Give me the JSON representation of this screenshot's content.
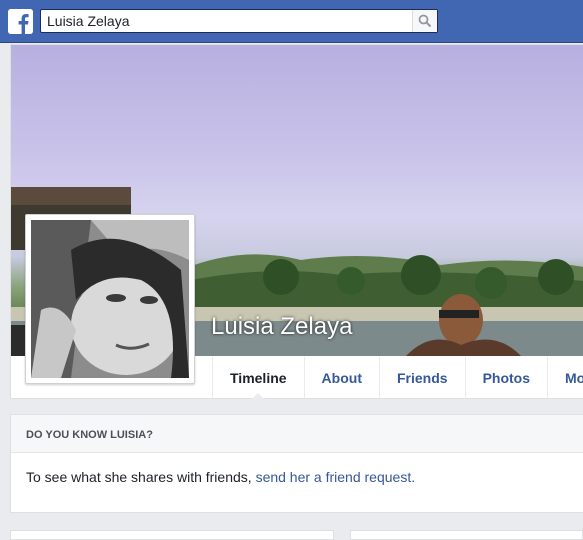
{
  "header": {
    "logo_icon": "facebook-logo-icon",
    "search": {
      "value": "Luisia Zelaya",
      "button_icon": "search-icon"
    }
  },
  "profile": {
    "name": "Luisia Zelaya",
    "tabs": [
      {
        "label": "Timeline",
        "active": true
      },
      {
        "label": "About"
      },
      {
        "label": "Friends"
      },
      {
        "label": "Photos"
      },
      {
        "label": "Mo"
      }
    ]
  },
  "know_box": {
    "title": "DO YOU KNOW LUISIA?",
    "text": "To see what she shares with friends,",
    "link": "send her a friend request."
  },
  "colors": {
    "brand": "#4267b2",
    "link": "#365899"
  }
}
